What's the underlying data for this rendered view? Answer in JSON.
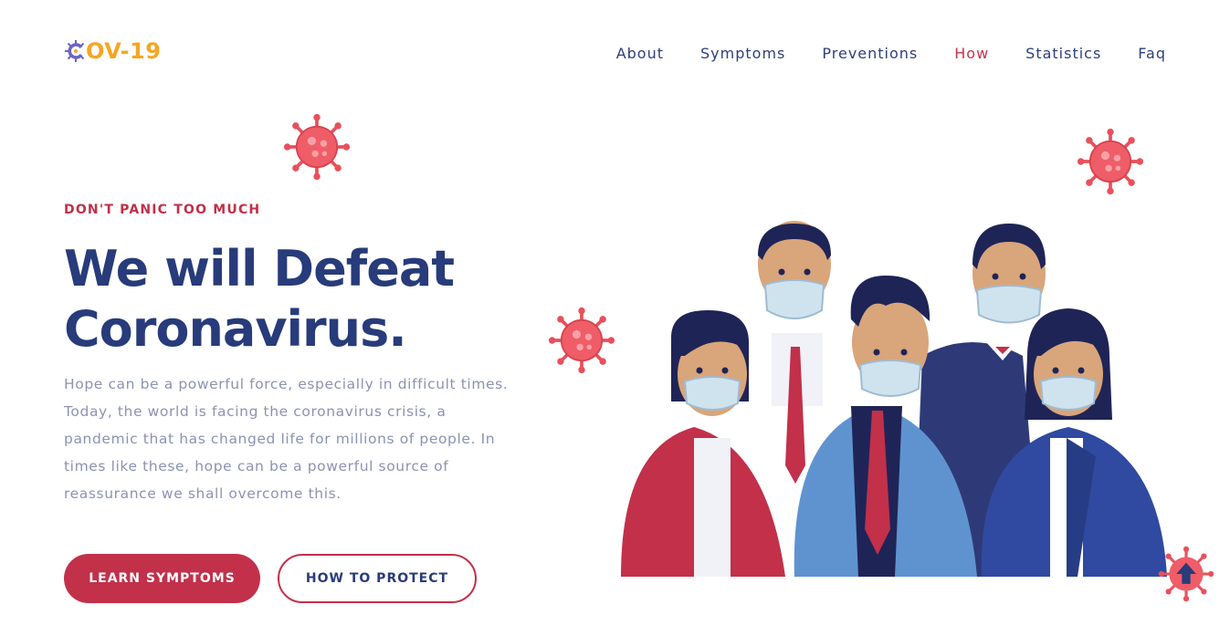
{
  "logo": {
    "text": "OV-19",
    "icon": "virus-c-icon"
  },
  "nav": {
    "items": [
      {
        "label": "About"
      },
      {
        "label": "Symptoms"
      },
      {
        "label": "Preventions"
      },
      {
        "label": "How",
        "active": true
      },
      {
        "label": "Statistics"
      },
      {
        "label": "Faq"
      }
    ]
  },
  "hero": {
    "eyebrow": "DON'T PANIC TOO MUCH",
    "headline_line1": "We will Defeat",
    "headline_line2": "Coronavirus.",
    "lead": "Hope can be a powerful force, especially in difficult times. Today, the world is facing the coronavirus crisis, a pandemic that has changed life for millions of people. In times like these, hope can be a powerful source of reassurance we shall overcome this.",
    "primary_button": "LEARN SYMPTOMS",
    "secondary_button": "HOW TO PROTECT"
  },
  "colors": {
    "brand_red": "#c2304a",
    "navy": "#283b7a",
    "logo_orange": "#f5a623",
    "logo_purple": "#6c63c7",
    "body_text": "#8c92b3",
    "virus_red": "#e8505b"
  },
  "icons": {
    "virus": "coronavirus-icon",
    "scroll_top": "arrow-up-icon"
  }
}
